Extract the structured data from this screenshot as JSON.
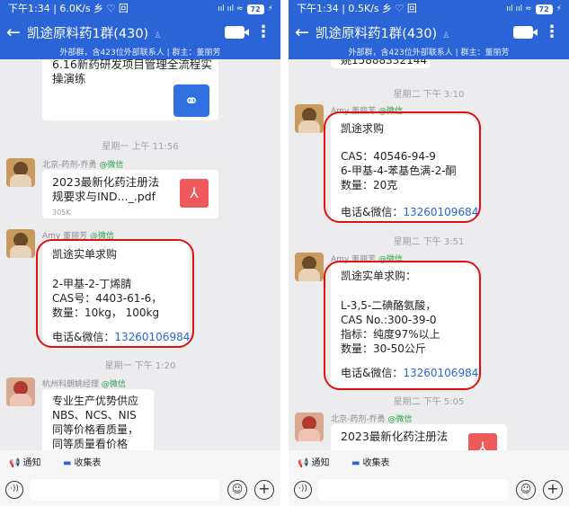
{
  "left": {
    "status": {
      "time_speed": "下午1:34 | 6.0K/s 乡 ♡ 回",
      "signal": "ııl ııl ≈",
      "battery": "72",
      "charge": "⚡"
    },
    "header": {
      "back": "←",
      "title": "凯途原料药1群(430)",
      "more": "⋮",
      "subtitle": "外部群，含423位外部联系人 | 群主：董丽芳"
    },
    "messages": [
      {
        "kind": "link_card",
        "text_lines": [
          "6.16新药研发项目管理全流程实",
          "操演练"
        ]
      },
      {
        "kind": "time",
        "text": "星期一 上午 11:56"
      },
      {
        "kind": "file",
        "sender": "北京-药剂-乔勇",
        "sender_tag": "@微信",
        "file_name_lines": [
          "2023最新化药注册法",
          "规要求与IND..._.pdf"
        ],
        "file_size": "305K"
      },
      {
        "kind": "text",
        "sender": "Amy 董丽芳",
        "sender_tag": "@微信",
        "lines": [
          "凯途实单求购",
          "",
          "2-甲基-2-丁烯腈",
          "CAS号：4403-61-6，",
          "数量：10kg， 100kg",
          ""
        ],
        "contact_label": "电话&微信：",
        "contact_phone": "13260106984"
      },
      {
        "kind": "time",
        "text": "星期一 下午 1:20"
      },
      {
        "kind": "text",
        "sender": "杭州科朗姚经理",
        "sender_tag": "@微信",
        "lines": [
          "专业生产优势供应",
          "NBS、NCS、NIS",
          "同等价格看质量，",
          "同等质量看价格"
        ]
      }
    ],
    "quick": [
      {
        "icon": "📢",
        "label": "通知"
      },
      {
        "icon": "▬",
        "label": "收集表"
      }
    ],
    "voice": "·))",
    "emoji": "☺",
    "plus": "+"
  },
  "right": {
    "status": {
      "time_speed": "下午1:34 | 0.5K/s 乡 ♡ 回",
      "signal": "ııl ııl ≈",
      "battery": "72",
      "charge": "⚡"
    },
    "header": {
      "back": "←",
      "title": "凯途原料药1群(430)",
      "more": "⋮",
      "subtitle": "外部群，含423位外部联系人 | 群主：董丽芳"
    },
    "messages": [
      {
        "kind": "partial",
        "text": "姚15888332144"
      },
      {
        "kind": "time",
        "text": "星期二 下午 3:10"
      },
      {
        "kind": "text",
        "sender": "Amy 董丽芳",
        "sender_tag": "@微信",
        "lines": [
          "凯途求购",
          "",
          "CAS：40546-94-9",
          "6-甲基-4-苯基色满-2-酮",
          "数量：20克",
          ""
        ],
        "contact_label": "电话&微信：",
        "contact_phone": "13260109684"
      },
      {
        "kind": "time",
        "text": "星期二 下午 3:51"
      },
      {
        "kind": "text",
        "sender": "Amy 董丽芳",
        "sender_tag": "@微信",
        "lines": [
          "凯途实单求购：",
          "",
          "L-3,5-二碘酪氨酸，",
          "CAS No.:300-39-0",
          "指标：纯度97%以上",
          "数量：30-50公斤",
          ""
        ],
        "contact_label": "电话&微信：",
        "contact_phone": "13260106984"
      },
      {
        "kind": "time",
        "text": "星期二 下午 5:05"
      },
      {
        "kind": "file",
        "sender": "北京-药剂-乔勇",
        "sender_tag": "@微信",
        "file_name_lines": [
          "2023最新化药注册法"
        ]
      }
    ],
    "quick": [
      {
        "icon": "📢",
        "label": "通知"
      },
      {
        "icon": "▬",
        "label": "收集表"
      }
    ],
    "voice": "·))",
    "emoji": "☺",
    "plus": "+"
  },
  "colors": {
    "header_blue": "#2a64d6",
    "chat_bg": "#ececee",
    "highlight_red": "#e01111",
    "wechat_green": "#2fa24a",
    "phone_blue": "#2a64d6"
  },
  "icons": [
    "arrow-left-icon",
    "video-camera-icon",
    "more-vertical-icon",
    "link-icon",
    "pdf-file-icon",
    "megaphone-icon",
    "form-icon",
    "voice-icon",
    "emoji-icon",
    "plus-icon"
  ]
}
